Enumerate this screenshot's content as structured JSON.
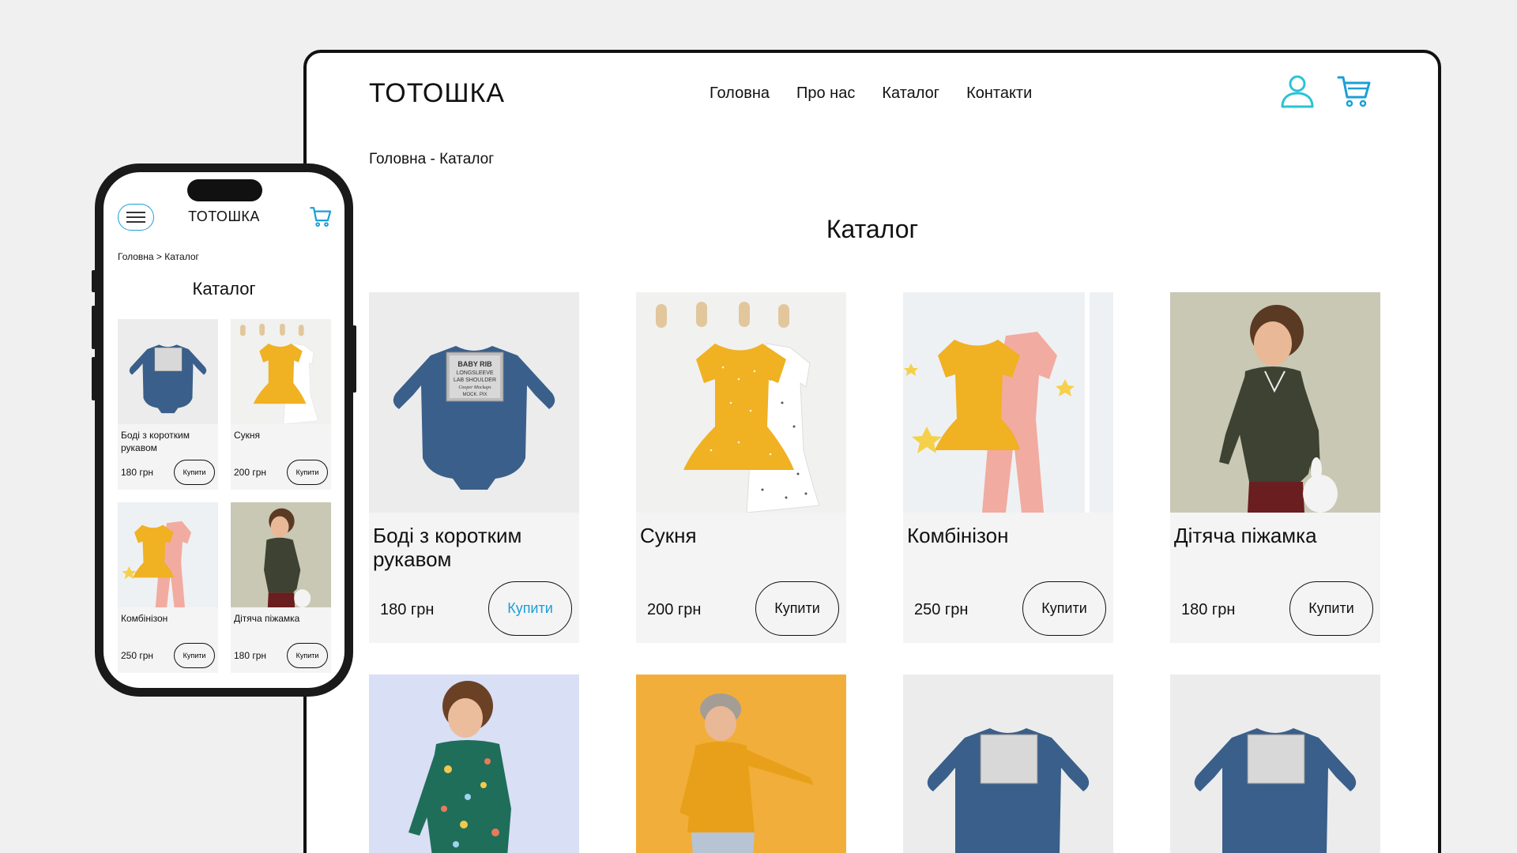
{
  "brand": "ТОТОШКА",
  "nav": [
    "Головна",
    "Про нас",
    "Каталог",
    "Контакти"
  ],
  "breadcrumb_desktop": "Головна - Каталог",
  "breadcrumb_mobile": "Головна > Каталог",
  "catalog_title": "Каталог",
  "buy_label": "Купити",
  "accent_color": "#1a9fd6",
  "icons": [
    "user-icon",
    "cart-icon",
    "menu-icon"
  ],
  "products": [
    {
      "name": "Боді з коротким рукавом",
      "price": "180 грн"
    },
    {
      "name": "Сукня",
      "price": "200 грн"
    },
    {
      "name": "Комбінізон",
      "price": "250 грн"
    },
    {
      "name": "Дітяча піжамка",
      "price": "180 грн"
    }
  ],
  "mockup_label": {
    "line1": "BABY RIB",
    "line2": "LONGSLEEVE",
    "line3": "LAB SHOULDER",
    "line4": "Cooper Mockups",
    "line5": "by",
    "line6": "MOCK. PIX"
  }
}
